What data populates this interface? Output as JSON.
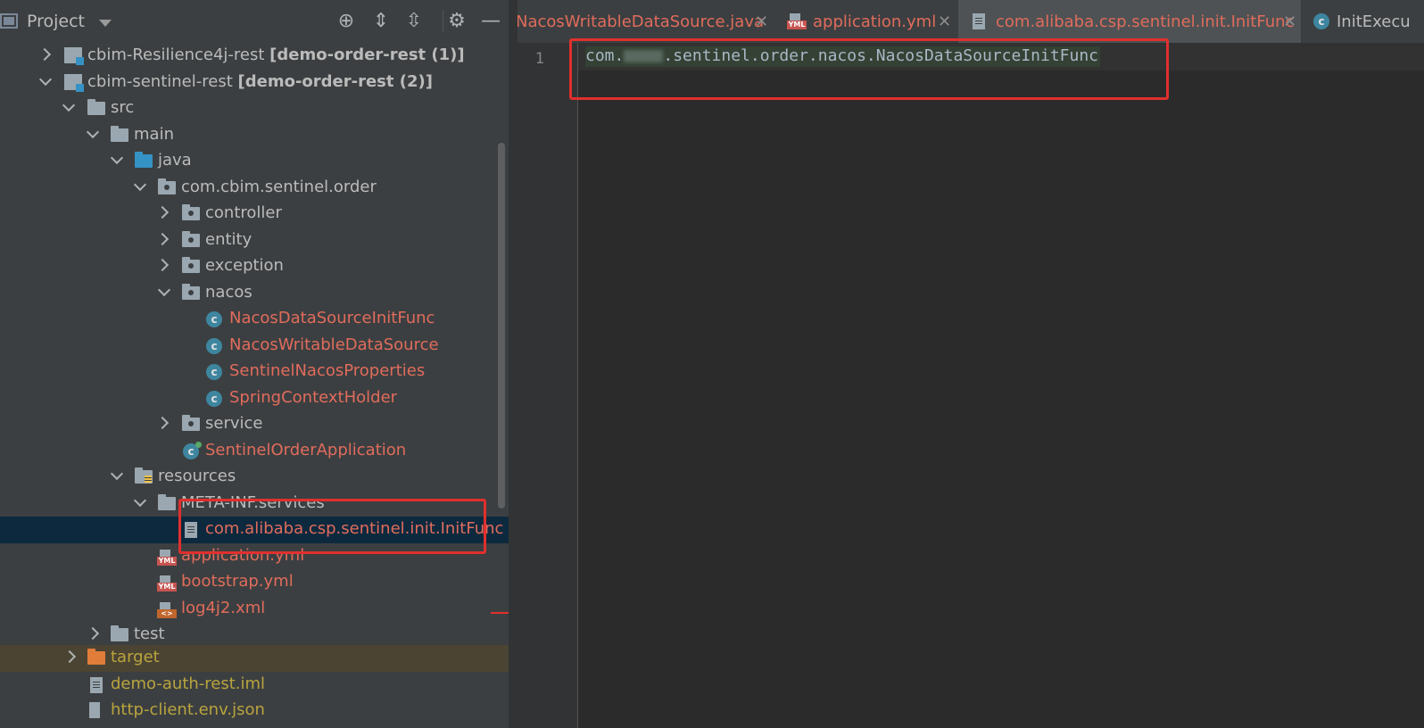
{
  "project_panel": {
    "title": "Project",
    "tree": [
      {
        "label": "cbim-Resilience4j-rest",
        "suffix": "[demo-order-rest (1)]"
      },
      {
        "label": "cbim-sentinel-rest",
        "suffix": "[demo-order-rest (2)]"
      },
      {
        "label": "src"
      },
      {
        "label": "main"
      },
      {
        "label": "java"
      },
      {
        "label": "com.cbim.sentinel.order"
      },
      {
        "label": "controller"
      },
      {
        "label": "entity"
      },
      {
        "label": "exception"
      },
      {
        "label": "nacos"
      },
      {
        "label": "NacosDataSourceInitFunc"
      },
      {
        "label": "NacosWritableDataSource"
      },
      {
        "label": "SentinelNacosProperties"
      },
      {
        "label": "SpringContextHolder"
      },
      {
        "label": "service"
      },
      {
        "label": "SentinelOrderApplication"
      },
      {
        "label": "resources"
      },
      {
        "label": "META-INF.services"
      },
      {
        "label": "com.alibaba.csp.sentinel.init.InitFunc"
      },
      {
        "label": "application.yml"
      },
      {
        "label": "bootstrap.yml"
      },
      {
        "label": "log4j2.xml"
      },
      {
        "label": "test"
      },
      {
        "label": "target"
      },
      {
        "label": "demo-auth-rest.iml"
      },
      {
        "label": "http-client.env.json"
      }
    ]
  },
  "editor": {
    "tabs": [
      {
        "label": "NacosWritableDataSource.java"
      },
      {
        "label": "application.yml"
      },
      {
        "label": "com.alibaba.csp.sentinel.init.InitFunc"
      },
      {
        "label": "InitExecu"
      }
    ],
    "line_number": "1",
    "code_prefix": "com.",
    "code_suffix": ".sentinel.order.nacos.NacosDataSourceInitFunc"
  },
  "icons": {
    "locate": "crosshair-icon",
    "expand": "expand-all-icon",
    "collapse": "collapse-all-icon",
    "settings": "gear-icon",
    "hide": "minimize-icon"
  },
  "colors": {
    "highlight_box": "#e0302e",
    "modified_file": "#e06c5c",
    "excluded_file": "#b9a43e",
    "selection": "#0d293e"
  }
}
